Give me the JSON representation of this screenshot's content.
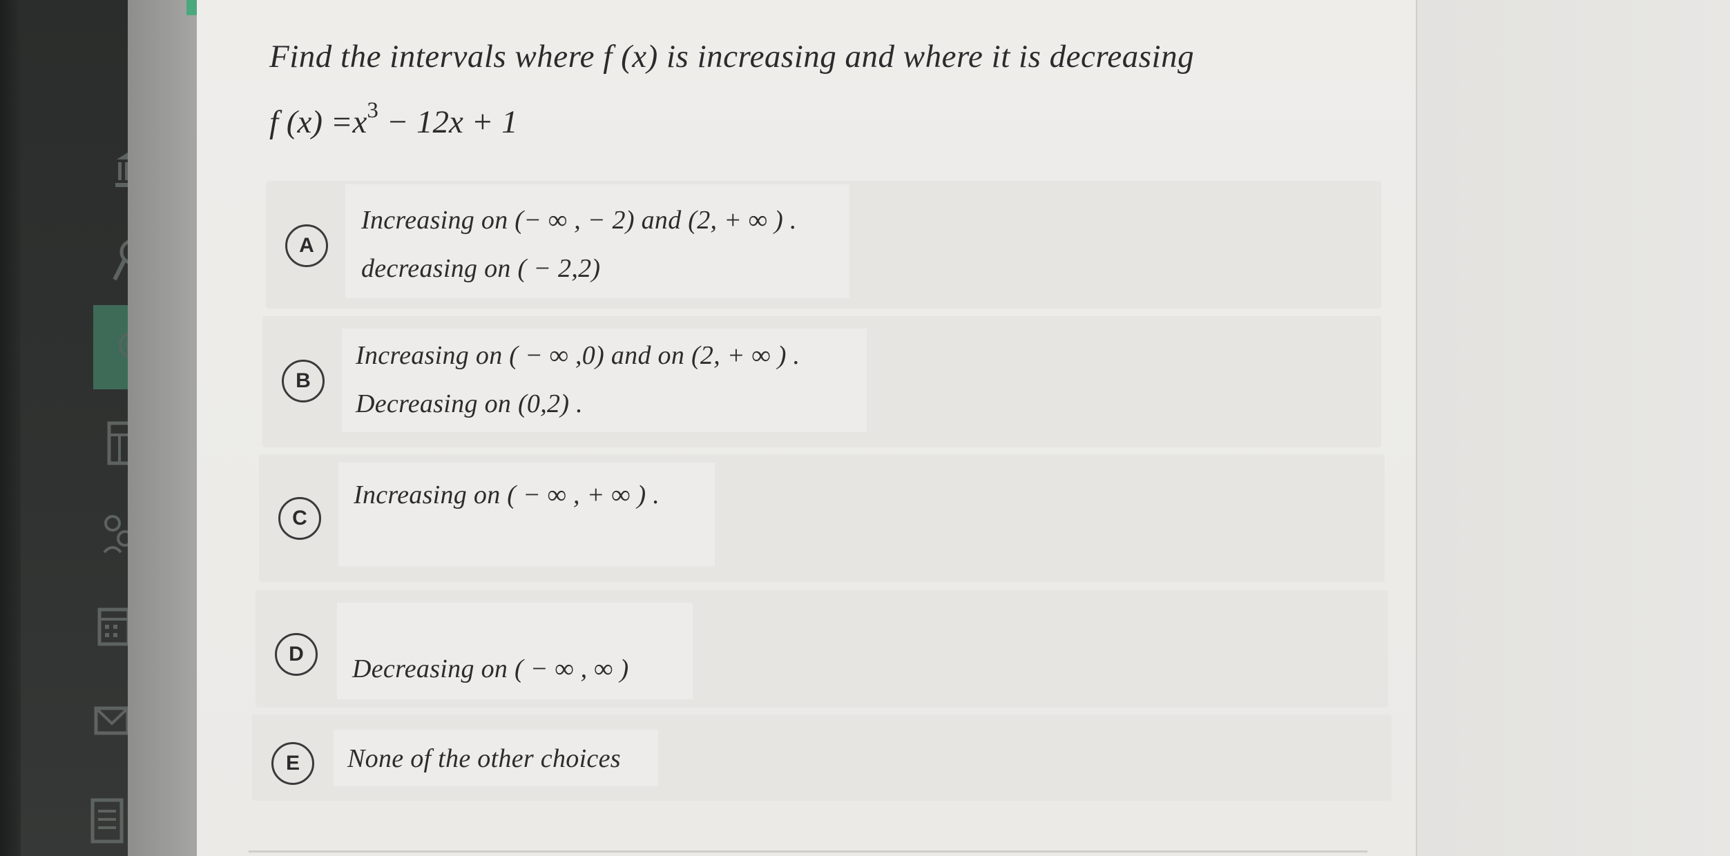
{
  "question": {
    "prompt": "Find the intervals where f (x) is increasing and where it is decreasing",
    "formula_left": "f (x) =x",
    "formula_exponent": "3",
    "formula_right": " − 12x + 1"
  },
  "options": [
    {
      "letter": "A",
      "line1": "Increasing on (− ∞ , − 2) and (2, + ∞ ) .",
      "line2": "decreasing on ( − 2,2)"
    },
    {
      "letter": "B",
      "line1": "Increasing on ( − ∞ ,0) and on (2, + ∞ ) .",
      "line2": "Decreasing on (0,2) ."
    },
    {
      "letter": "C",
      "line1": "Increasing on ( − ∞ , + ∞ ) ."
    },
    {
      "letter": "D",
      "line1": "Decreasing on ( − ∞ , ∞ )"
    },
    {
      "letter": "E",
      "line1": "None of the other choices"
    }
  ],
  "sidebar_icons": [
    "bank-icon",
    "search-icon",
    "globe-icon",
    "layout-icon",
    "users-icon",
    "calendar-icon",
    "mail-icon",
    "document-icon"
  ],
  "colors": {
    "accent": "#4aa87c",
    "sidebar": "#2f3130",
    "nav_active": "#3e6b58"
  }
}
